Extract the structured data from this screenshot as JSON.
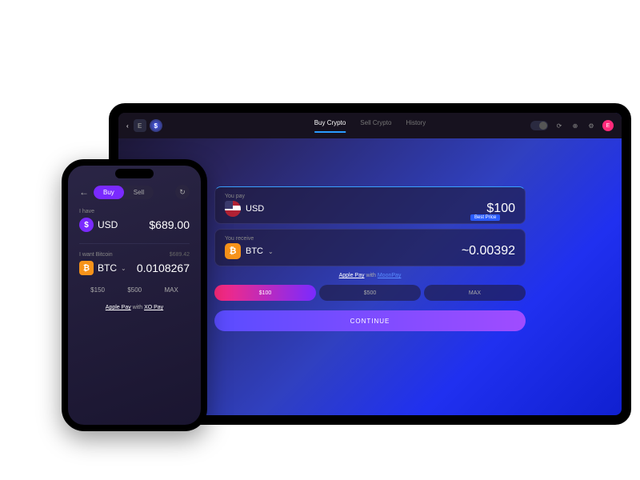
{
  "desktop": {
    "topbar": {
      "tabs": {
        "buy": "Buy Crypto",
        "sell": "Sell Crypto",
        "history": "History"
      },
      "avatar_letter": "E"
    },
    "pay_card": {
      "label": "You pay",
      "symbol": "USD",
      "amount": "$100"
    },
    "receive_card": {
      "label": "You receive",
      "symbol": "BTC",
      "amount": "~0.00392",
      "badge": "Best Price"
    },
    "pay_note": {
      "apple": "Apple Pay",
      "with": " with ",
      "provider": "MoonPay"
    },
    "quick": {
      "a": "$100",
      "b": "$500",
      "c": "MAX"
    },
    "continue": "CONTINUE"
  },
  "phone": {
    "tabs": {
      "buy": "Buy",
      "sell": "Sell"
    },
    "have": {
      "label": "I have",
      "symbol": "USD",
      "amount": "$689.00"
    },
    "want": {
      "label": "I want Bitcoin",
      "est": "$689.42",
      "symbol": "BTC",
      "amount": "0.0108267"
    },
    "quick": {
      "a": "$150",
      "b": "$500",
      "c": "MAX"
    },
    "pay_note": {
      "apple": "Apple Pay",
      "with": " with ",
      "provider": "XO Pay"
    }
  }
}
